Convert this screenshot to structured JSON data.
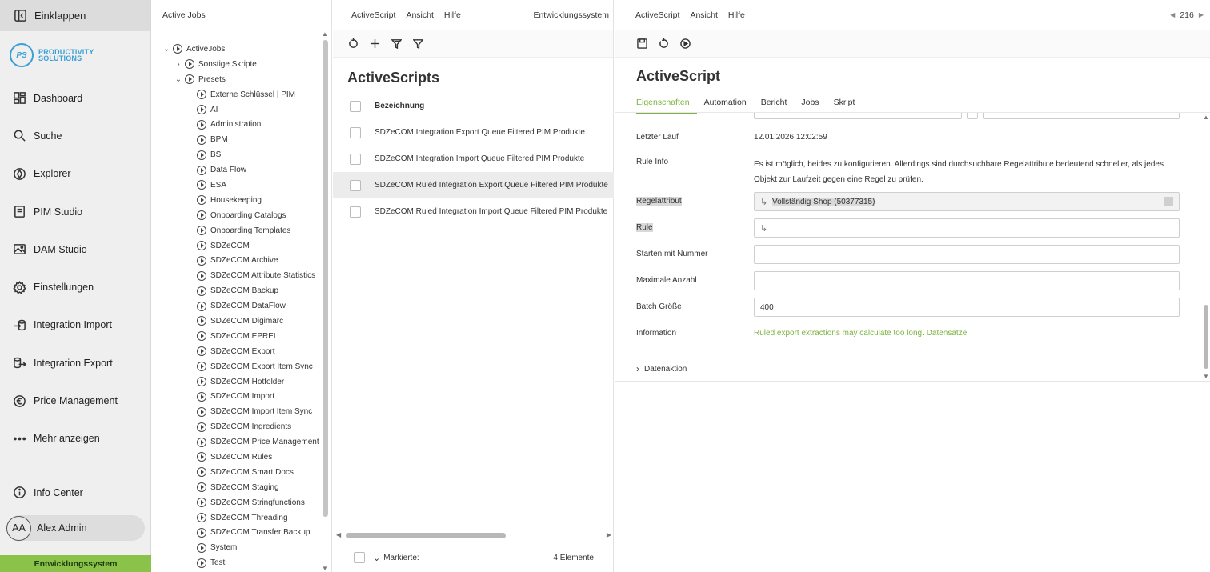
{
  "nav": {
    "collapse_label": "Einklappen",
    "logo_initials": "PS",
    "logo_line1": "PRODUCTIVITY",
    "logo_line2": "SOLUTIONS",
    "items": [
      {
        "label": "Dashboard",
        "icon": "dashboard-icon"
      },
      {
        "label": "Suche",
        "icon": "search-icon"
      },
      {
        "label": "Explorer",
        "icon": "explorer-icon"
      },
      {
        "label": "PIM Studio",
        "icon": "pim-studio-icon"
      },
      {
        "label": "DAM Studio",
        "icon": "image-icon"
      },
      {
        "label": "Einstellungen",
        "icon": "gear-icon"
      },
      {
        "label": "Integration Import",
        "icon": "import-icon"
      },
      {
        "label": "Integration Export",
        "icon": "export-icon"
      },
      {
        "label": "Price Management",
        "icon": "euro-icon"
      },
      {
        "label": "Mehr anzeigen",
        "icon": "more-icon"
      }
    ],
    "info_center": "Info Center",
    "user_initials": "AA",
    "user_name": "Alex Admin",
    "environment": "Entwicklungssystem",
    "environment_color": "#8bc34a"
  },
  "tree": {
    "header": "Active Jobs",
    "root": "ActiveJobs",
    "sonstige": "Sonstige Skripte",
    "presets": "Presets",
    "children": [
      "Externe Schlüssel | PIM",
      "AI",
      "Administration",
      "BPM",
      "BS",
      "Data Flow",
      "ESA",
      "Housekeeping",
      "Onboarding Catalogs",
      "Onboarding Templates",
      "SDZeCOM",
      "SDZeCOM Archive",
      "SDZeCOM Attribute Statistics",
      "SDZeCOM Backup",
      "SDZeCOM DataFlow",
      "SDZeCOM Digimarc",
      "SDZeCOM EPREL",
      "SDZeCOM Export",
      "SDZeCOM Export Item Sync",
      "SDZeCOM Hotfolder",
      "SDZeCOM Import",
      "SDZeCOM Import Item Sync",
      "SDZeCOM Ingredients",
      "SDZeCOM Price Management",
      "SDZeCOM Rules",
      "SDZeCOM Smart Docs",
      "SDZeCOM Staging",
      "SDZeCOM Stringfunctions",
      "SDZeCOM Threading",
      "SDZeCOM Transfer Backup",
      "System",
      "Test"
    ]
  },
  "mid": {
    "menu": [
      "ActiveScript",
      "Ansicht",
      "Hilfe"
    ],
    "env_label": "Entwicklungssystem",
    "title": "ActiveScripts",
    "column_header": "Bezeichnung",
    "rows": [
      "SDZeCOM Integration Export Queue Filtered PIM Produkte",
      "SDZeCOM Integration Import Queue Filtered PIM Produkte",
      "SDZeCOM Ruled Integration Export Queue Filtered PIM Produkte",
      "SDZeCOM Ruled Integration Import Queue Filtered PIM Produkte"
    ],
    "selected_row": 2,
    "footer_label": "Markierte:",
    "footer_count": "4 Elemente"
  },
  "right": {
    "menu": [
      "ActiveScript",
      "Ansicht",
      "Hilfe"
    ],
    "page_number": "216",
    "title": "ActiveScript",
    "tabs": [
      "Eigenschaften",
      "Automation",
      "Bericht",
      "Jobs",
      "Skript"
    ],
    "active_tab": 0,
    "fields": {
      "letzter_lauf_label": "Letzter Lauf",
      "letzter_lauf_value": "12.01.2026 12:02:59",
      "rule_info_label": "Rule Info",
      "rule_info_value": "Es ist möglich, beides zu konfigurieren. Allerdings sind durchsuchbare Regelattribute bedeutend schneller, als jedes Objekt zur Laufzeit gegen eine Regel zu prüfen.",
      "regelattribut_label": "Regelattribut",
      "regelattribut_value": "Vollständig Shop (50377315)",
      "rule_label": "Rule",
      "rule_value": "",
      "starten_label": "Starten mit Nummer",
      "starten_value": "",
      "max_label": "Maximale Anzahl",
      "max_value": "",
      "batch_label": "Batch Größe",
      "batch_value": "400",
      "information_label": "Information",
      "information_value": "Ruled export extractions may calculate too long. Datensätze"
    },
    "section": "Datenaktion",
    "accent_color": "#7cb342"
  }
}
